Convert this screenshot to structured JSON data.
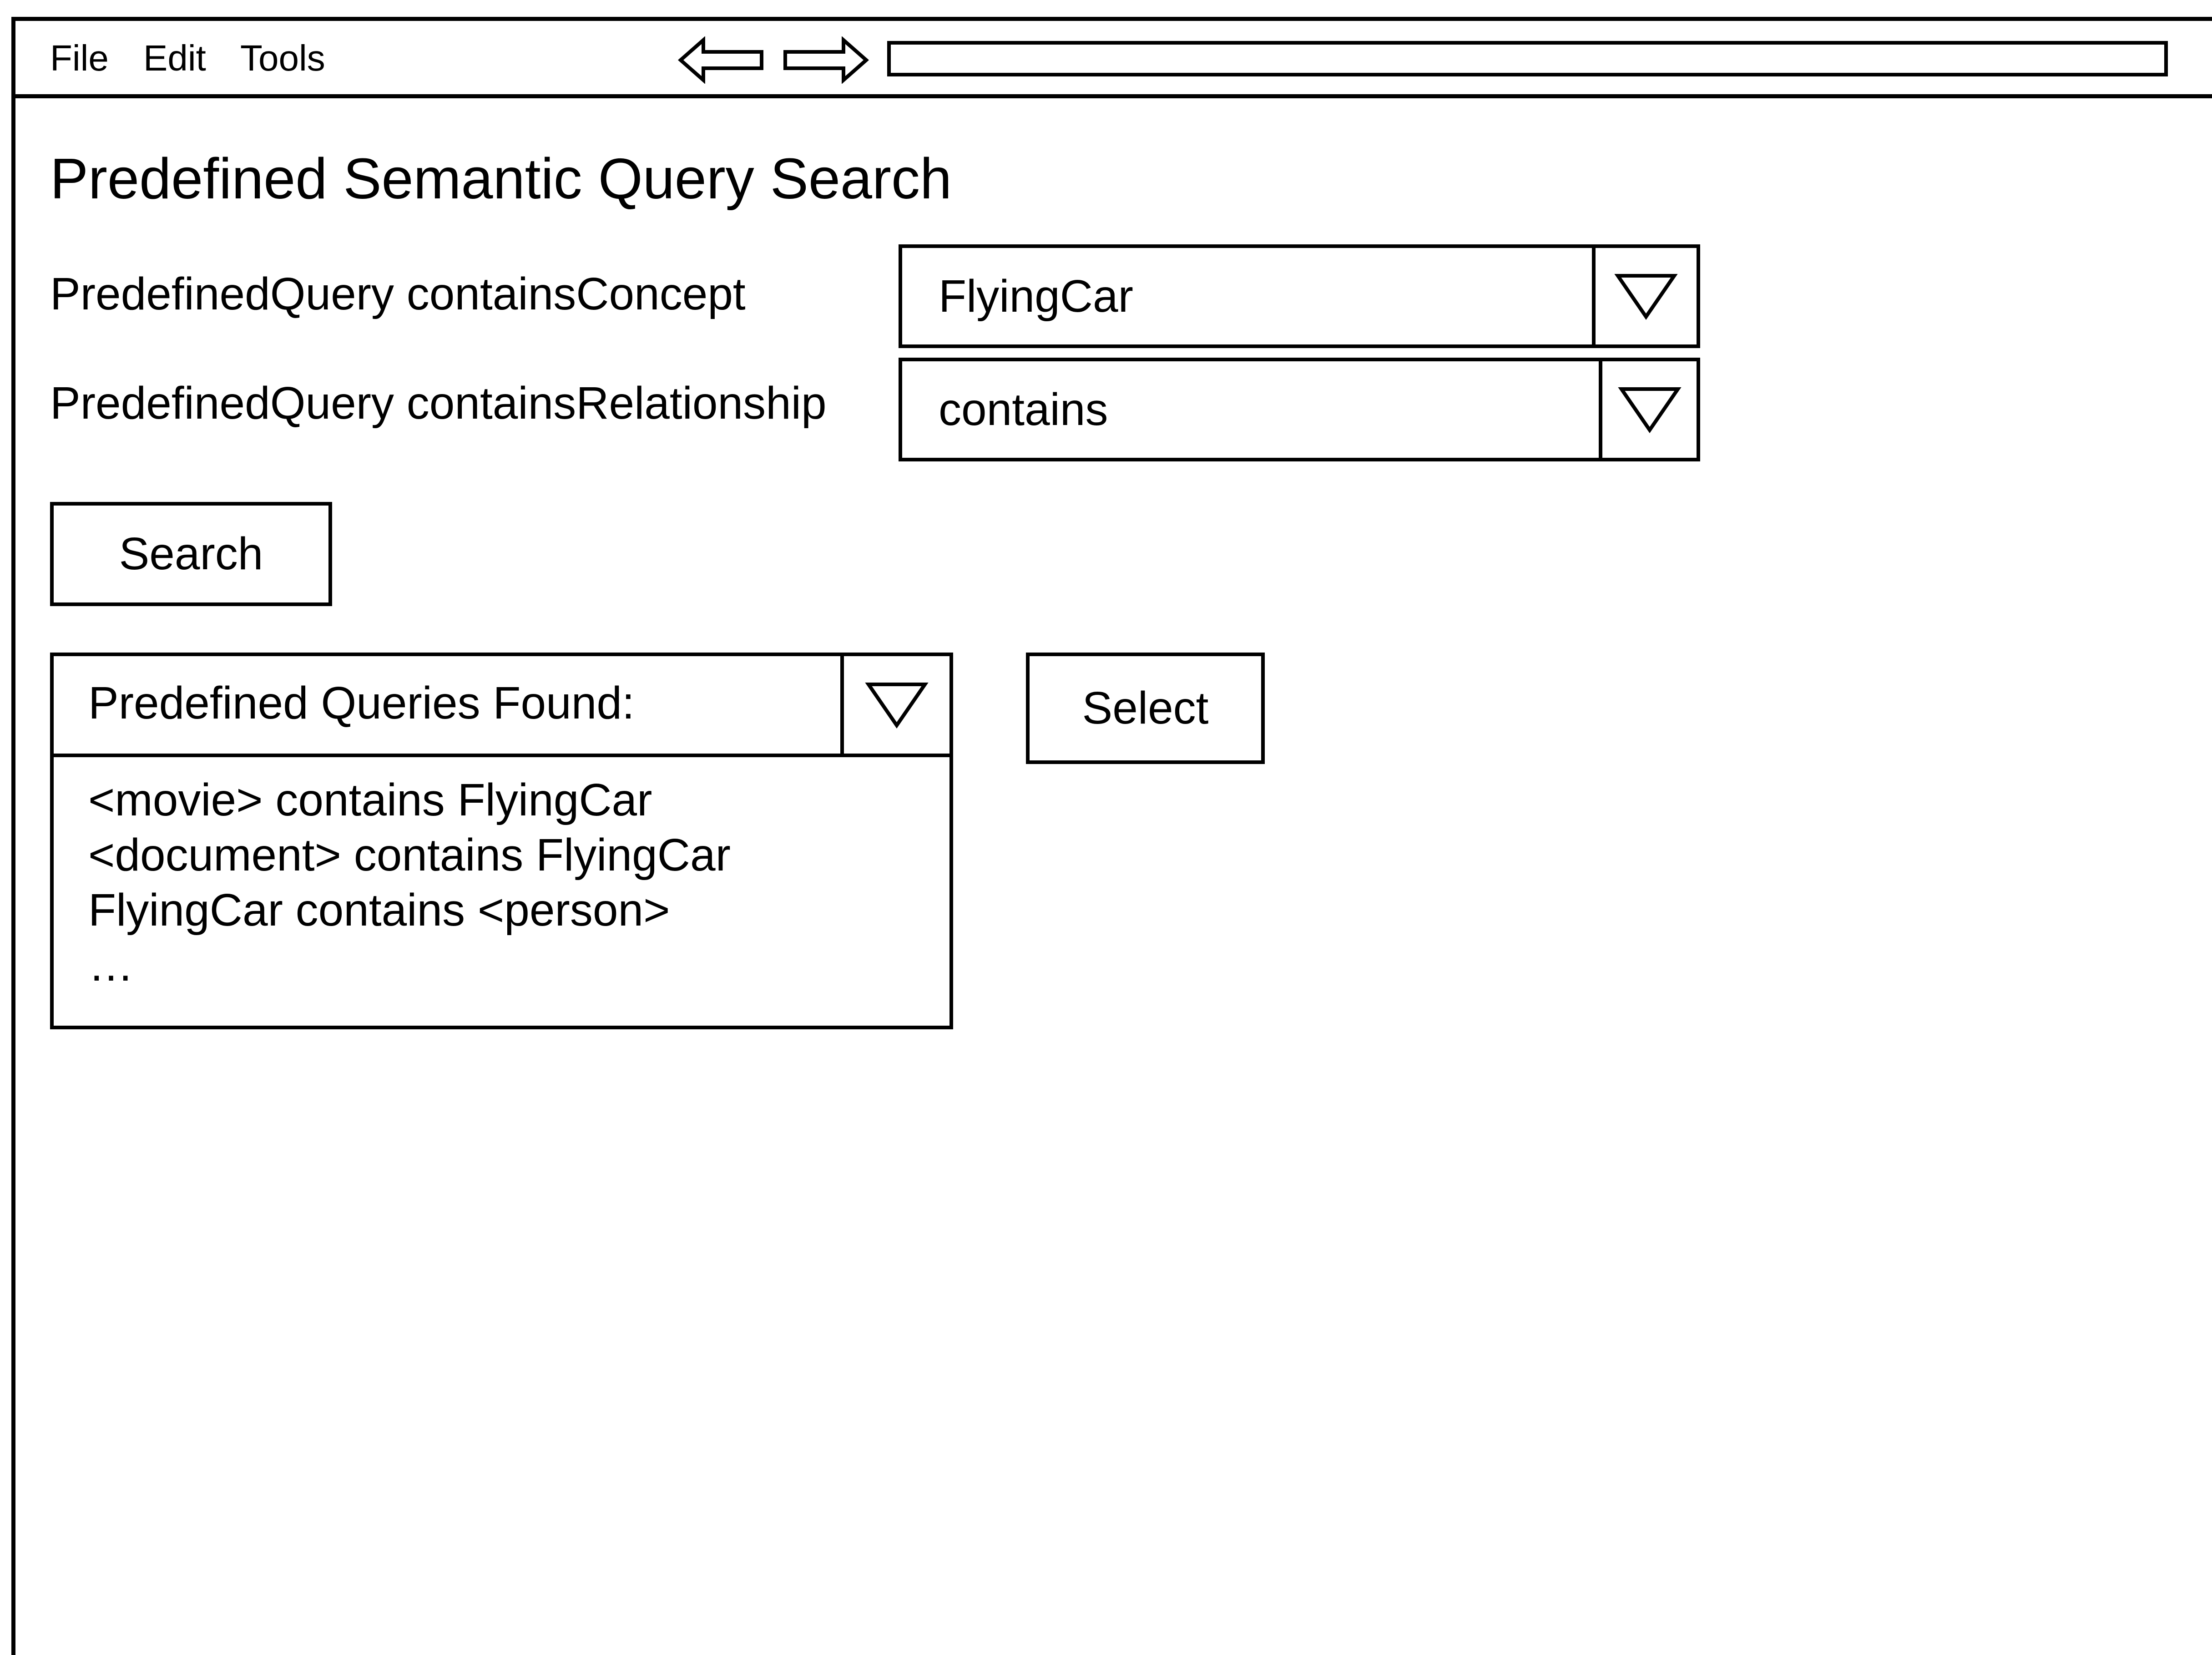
{
  "menu": {
    "file": "File",
    "edit": "Edit",
    "tools": "Tools"
  },
  "nav": {
    "back_icon": "left-arrow-icon",
    "forward_icon": "right-arrow-icon",
    "address_value": ""
  },
  "page": {
    "title": "Predefined Semantic Query Search"
  },
  "form": {
    "concept_label": "PredefinedQuery containsConcept",
    "concept_value": "FlyingCar",
    "relationship_label": "PredefinedQuery containsRelationship",
    "relationship_value": "contains",
    "dropdown_icon": "triangle-down-icon"
  },
  "search_button": "Search",
  "results": {
    "header": "Predefined Queries Found:",
    "items": [
      "<movie> contains FlyingCar",
      "<document> contains FlyingCar",
      "FlyingCar contains <person>",
      "…"
    ]
  },
  "select_button": "Select",
  "colors": {
    "stroke": "#000000",
    "background": "#ffffff"
  }
}
